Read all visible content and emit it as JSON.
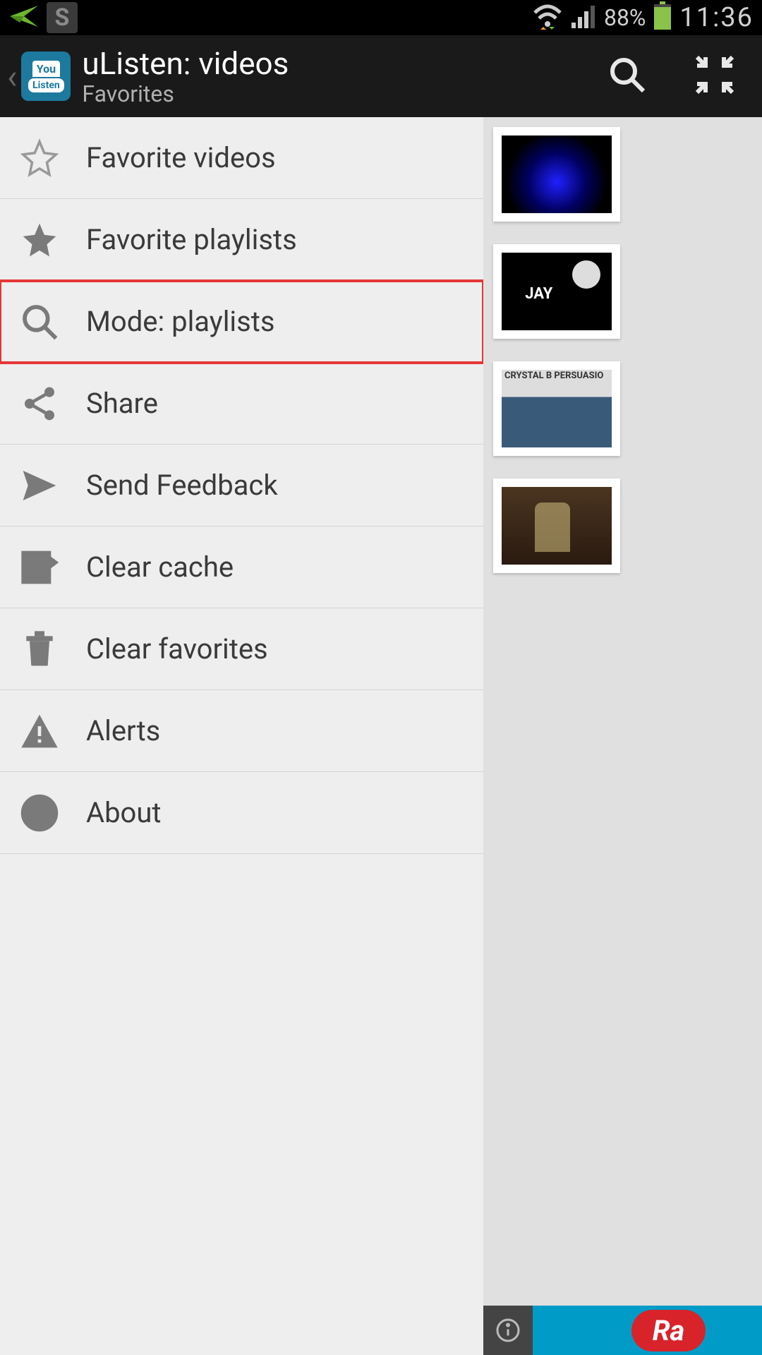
{
  "status": {
    "battery_pct": "88%",
    "time": "11:36",
    "s_label": "S"
  },
  "actionbar": {
    "title": "uListen: videos",
    "subtitle": "Favorites"
  },
  "app_icon": {
    "top": "You",
    "bottom": "Listen"
  },
  "menu": {
    "items": [
      {
        "label": "Favorite videos",
        "icon": "star-outline",
        "highlight": false
      },
      {
        "label": "Favorite playlists",
        "icon": "star",
        "highlight": false
      },
      {
        "label": "Mode: playlists",
        "icon": "search",
        "highlight": true
      },
      {
        "label": "Share",
        "icon": "share",
        "highlight": false
      },
      {
        "label": "Send Feedback",
        "icon": "send",
        "highlight": false
      },
      {
        "label": "Clear cache",
        "icon": "scissors",
        "highlight": false
      },
      {
        "label": "Clear favorites",
        "icon": "trash",
        "highlight": false
      },
      {
        "label": "Alerts",
        "icon": "alert",
        "highlight": false
      },
      {
        "label": "About",
        "icon": "info",
        "highlight": false
      }
    ]
  },
  "ad": {
    "text": "Ra"
  }
}
